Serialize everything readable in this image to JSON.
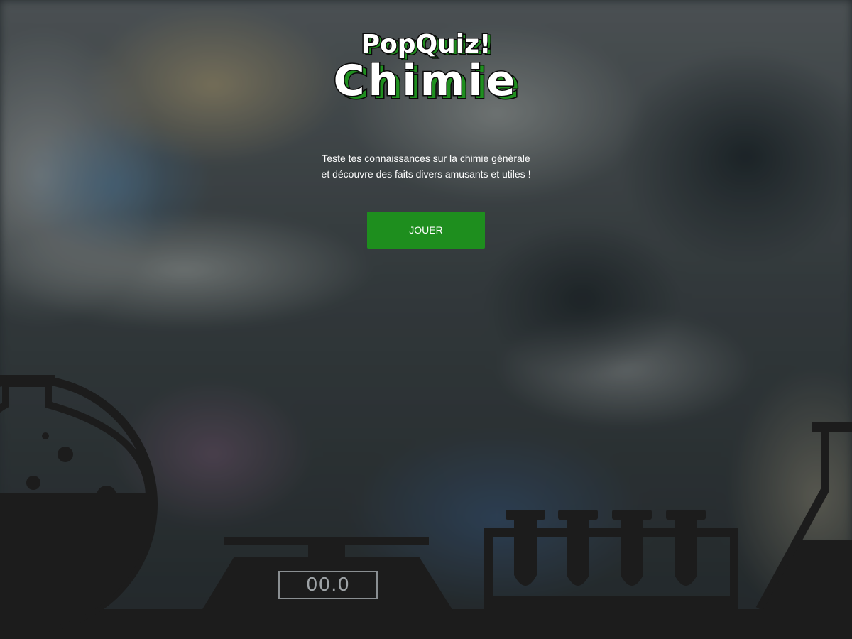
{
  "app": {
    "logo_line1": "PopQuiz!",
    "logo_line2": "Chimie"
  },
  "intro": {
    "description": "Teste tes connaissances sur la chimie générale et découvre des faits divers amusants et utiles !"
  },
  "actions": {
    "play_label": "JOUER"
  },
  "scale": {
    "reading": "00.0"
  },
  "colors": {
    "accent": "#1e8e1e",
    "logo_shadow": "#1f8f1f",
    "silhouette": "#1c1c1c"
  },
  "icons": {
    "flask": "round-bottom-flask-icon",
    "scale": "lab-scale-icon",
    "test_tube_rack": "test-tube-rack-icon",
    "beaker": "erlenmeyer-flask-icon"
  }
}
